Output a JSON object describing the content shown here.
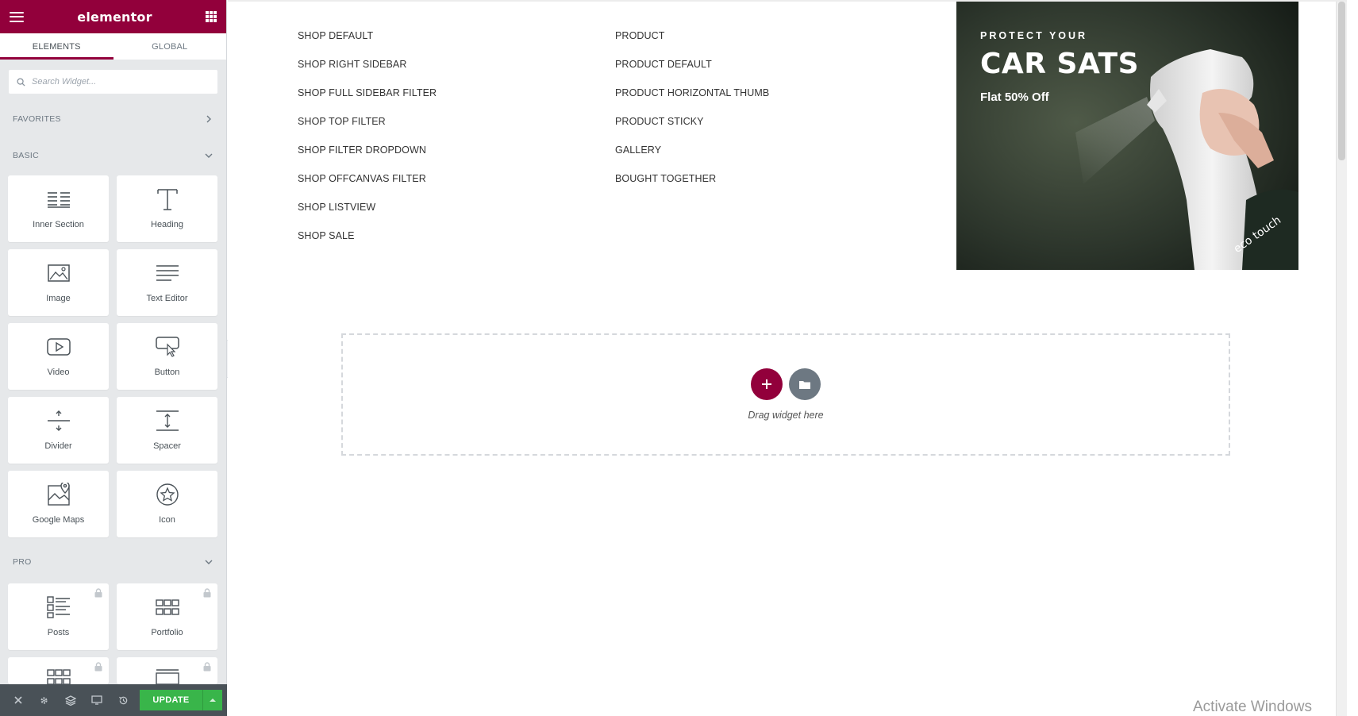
{
  "panel": {
    "brand": "elementor",
    "tabs": [
      {
        "label": "ELEMENTS",
        "active": true
      },
      {
        "label": "GLOBAL",
        "active": false
      }
    ],
    "search": {
      "placeholder": "Search Widget..."
    },
    "categories": {
      "favorites": "FAVORITES",
      "basic": "BASIC",
      "pro": "PRO"
    },
    "basic_widgets": [
      "Inner Section",
      "Heading",
      "Image",
      "Text Editor",
      "Video",
      "Button",
      "Divider",
      "Spacer",
      "Google Maps",
      "Icon"
    ],
    "pro_widgets": [
      "Posts",
      "Portfolio"
    ],
    "footer": {
      "update_label": "UPDATE"
    }
  },
  "preview": {
    "menu_left": [
      "SHOP DEFAULT",
      "SHOP RIGHT SIDEBAR",
      "SHOP FULL SIDEBAR FILTER",
      "SHOP TOP FILTER",
      "SHOP FILTER DROPDOWN",
      "SHOP OFFCANVAS FILTER",
      "SHOP LISTVIEW",
      "SHOP SALE"
    ],
    "menu_right": [
      "PRODUCT",
      "PRODUCT DEFAULT",
      "PRODUCT HORIZONTAL THUMB",
      "PRODUCT STICKY",
      "GALLERY",
      "BOUGHT TOGETHER"
    ],
    "promo": {
      "kicker": "PROTECT YOUR",
      "headline": "CAR SATS",
      "offer": "Flat 50% Off",
      "bottle_text": "eco touch"
    },
    "drop_zone": {
      "text": "Drag widget here"
    }
  },
  "os": {
    "watermark": "Activate Windows"
  },
  "colors": {
    "brand": "#92003b",
    "update": "#39b54a",
    "footer": "#495157",
    "panel_bg": "#e6e8ea"
  }
}
